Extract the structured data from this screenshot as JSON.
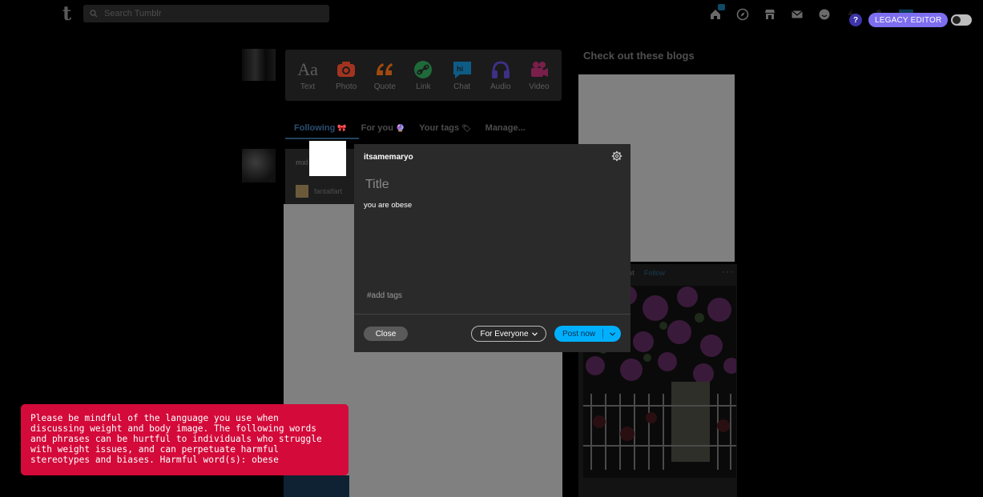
{
  "header": {
    "search": {
      "placeholder": "Search Tumblr",
      "value": ""
    },
    "nav_icons": [
      "home-icon",
      "explore-icon",
      "shop-icon",
      "inbox-icon",
      "chat-icon",
      "activity-icon",
      "account-icon",
      "create-icon"
    ],
    "help_label": "?",
    "legacy_editor_label": "LEGACY EDITOR"
  },
  "composer_bar": {
    "items": [
      {
        "label": "Text",
        "icon": "text-icon",
        "color": "#5c5c5c"
      },
      {
        "label": "Photo",
        "icon": "camera-icon",
        "color": "#a2341f"
      },
      {
        "label": "Quote",
        "icon": "quote-icon",
        "color": "#a14a10"
      },
      {
        "label": "Link",
        "icon": "link-icon",
        "color": "#1f6a3a"
      },
      {
        "label": "Chat",
        "icon": "chat-bubble-icon",
        "color": "#0d5c86"
      },
      {
        "label": "Audio",
        "icon": "headphones-icon",
        "color": "#3f2f85"
      },
      {
        "label": "Video",
        "icon": "video-camera-icon",
        "color": "#7a1f4a"
      }
    ]
  },
  "feed_tabs": [
    {
      "label": "Following",
      "emoji": "🎀",
      "active": true
    },
    {
      "label": "For you",
      "emoji": "🔮",
      "active": false
    },
    {
      "label": "Your tags",
      "emoji": "🏷",
      "active": false
    },
    {
      "label": "Manage...",
      "emoji": "",
      "active": false
    }
  ],
  "feed": {
    "post_user": "mxl",
    "reblog_user": "fantalfart"
  },
  "sidebar": {
    "title": "Check out these blogs",
    "follow_label": "Follow",
    "owner_label": "out"
  },
  "modal": {
    "username": "itsamemaryo",
    "title_placeholder": "Title",
    "title_value": "",
    "body_text": "you are obese",
    "tags_placeholder": "#add tags",
    "close_label": "Close",
    "audience_label": "For Everyone",
    "post_label": "Post now"
  },
  "warning": {
    "text": "Please be mindful of the language you use when\ndiscussing weight and body image. The following words\nand phrases can be hurtful to individuals who struggle\nwith weight issues, and can perpetuate harmful\nstereotypes and biases. Harmful word(s): obese",
    "color": "#d30a3a"
  }
}
